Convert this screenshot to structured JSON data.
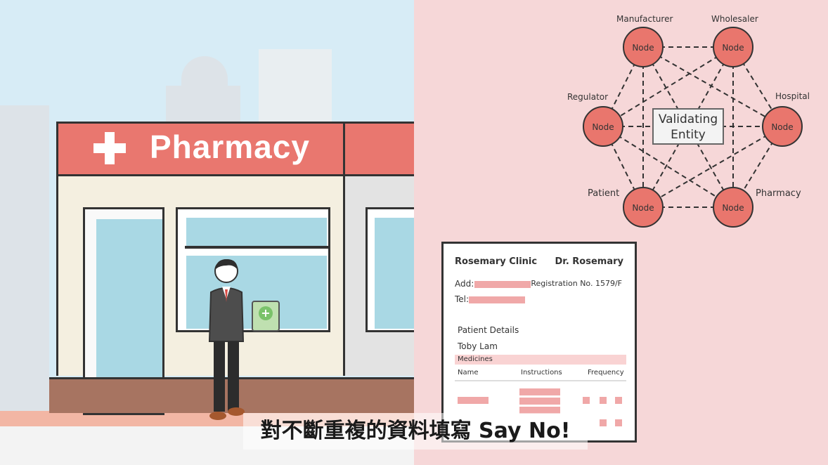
{
  "shop": {
    "sign_text": "Pharmacy"
  },
  "network": {
    "center_line1": "Validating",
    "center_line2": "Entity",
    "nodes": [
      {
        "label": "Manufacturer",
        "text": "Node"
      },
      {
        "label": "Wholesaler",
        "text": "Node"
      },
      {
        "label": "Regulator",
        "text": "Node"
      },
      {
        "label": "Hospital",
        "text": "Node"
      },
      {
        "label": "Patient",
        "text": "Node"
      },
      {
        "label": "Pharmacy",
        "text": "Node"
      }
    ],
    "colors": {
      "node_fill": "#e9766d",
      "edge": "#333333"
    }
  },
  "prescription": {
    "clinic": "Rosemary Clinic",
    "doctor": "Dr. Rosemary",
    "add_label": "Add:",
    "tel_label": "Tel:",
    "registration": "Registration No. 1579/F",
    "patient_details": "Patient Details",
    "patient_name": "Toby Lam",
    "medicines": "Medicines",
    "col_name": "Name",
    "col_instructions": "Instructions",
    "col_frequency": "Frequency"
  },
  "subtitle": "對不斷重複的資料填寫 Say No!"
}
